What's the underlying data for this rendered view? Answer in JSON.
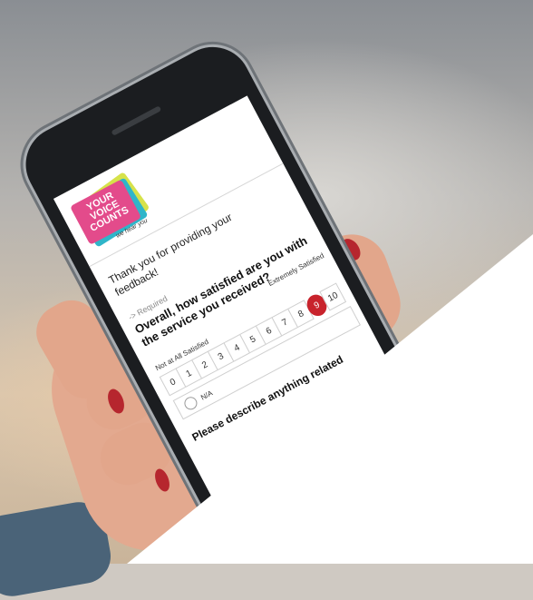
{
  "survey": {
    "logo": {
      "line1": "YOUR",
      "line2": "VOICE",
      "line3": "COUNTS",
      "tagline": "we hear you"
    },
    "thanks_text": "Thank you for providing your feedback!",
    "required_label": "-> Required",
    "question": "Overall, how satisfied are you with the service you received?",
    "scale": {
      "low_label": "Not at All Satisfied",
      "high_label": "Extremely Satisfied",
      "options": [
        "0",
        "1",
        "2",
        "3",
        "4",
        "5",
        "6",
        "7",
        "8",
        "9",
        "10"
      ],
      "selected": "9"
    },
    "na_label": "N/A",
    "next_question_partial": "Please describe anything related"
  },
  "colors": {
    "selected": "#c8232c",
    "logo_pink": "#e34b8b",
    "logo_blue": "#2fb5c9",
    "logo_yellow": "#d6e24a",
    "nail_polish": "#b6262e"
  }
}
